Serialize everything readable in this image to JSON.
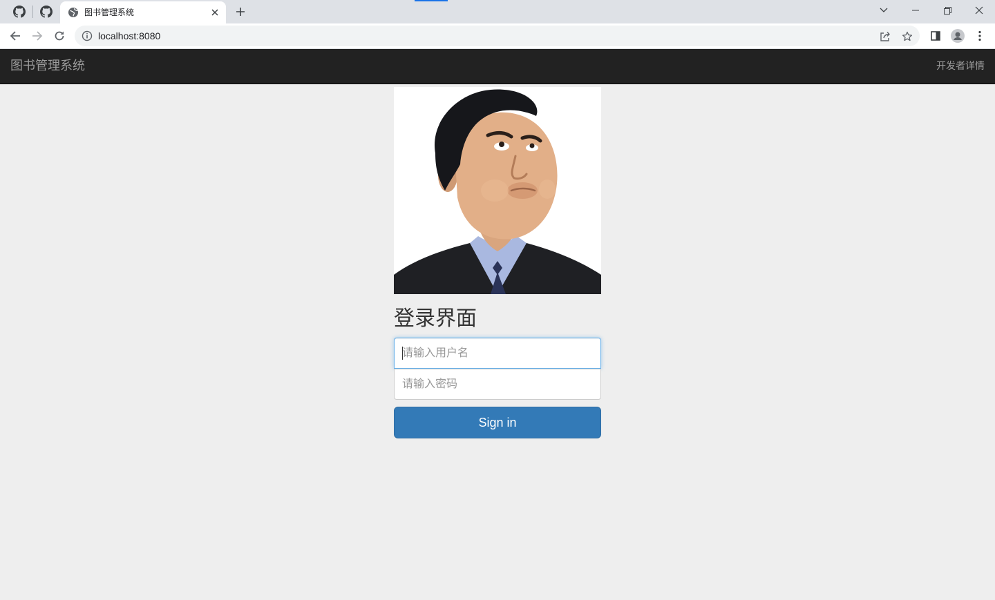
{
  "browser": {
    "tab": {
      "title": "图书管理系统"
    },
    "address": {
      "url": "localhost:8080"
    }
  },
  "navbar": {
    "brand": "图书管理系统",
    "developer_link": "开发者详情"
  },
  "login": {
    "title": "登录界面",
    "username_placeholder": "请输入用户名",
    "password_placeholder": "请输入密码",
    "signin_label": "Sign in"
  },
  "colors": {
    "navbar_bg": "#222222",
    "page_bg": "#eeeeee",
    "primary_button": "#337ab7",
    "focus_border": "#66afe9"
  }
}
